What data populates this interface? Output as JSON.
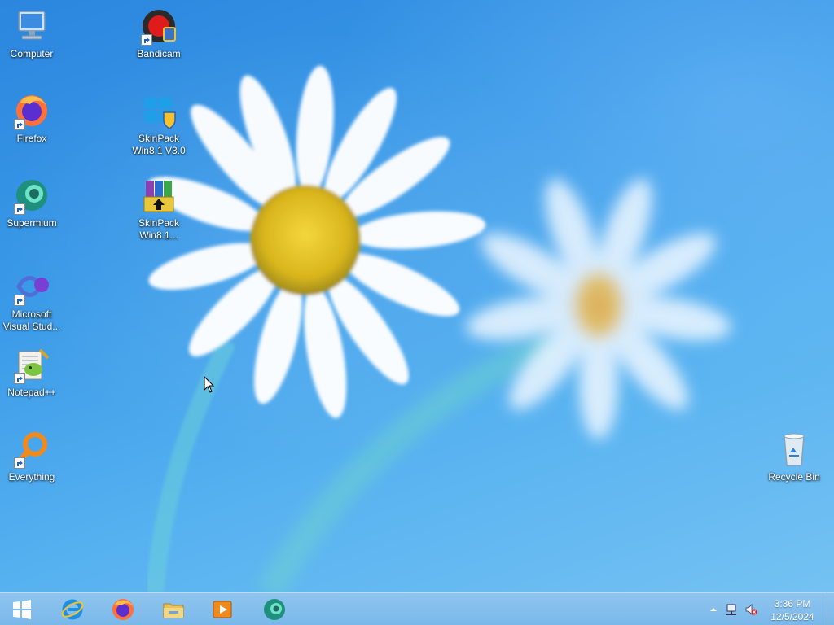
{
  "desktop": {
    "icons": [
      {
        "label": "Computer",
        "icon": "computer-icon"
      },
      {
        "label": "Firefox",
        "icon": "firefox-icon"
      },
      {
        "label": "Supermium",
        "icon": "supermium-icon"
      },
      {
        "label": "Microsoft Visual Stud...",
        "icon": "visual-studio-icon"
      },
      {
        "label": "Notepad++",
        "icon": "notepad-plus-plus-icon"
      },
      {
        "label": "Everything",
        "icon": "everything-search-icon"
      },
      {
        "label": "Bandicam",
        "icon": "bandicam-icon"
      },
      {
        "label": "SkinPack Win8.1 V3.0",
        "icon": "skinpack-installer-icon"
      },
      {
        "label": "SkinPack Win8.1...",
        "icon": "winrar-archive-icon"
      },
      {
        "label": "Recycle Bin",
        "icon": "recycle-bin-icon"
      }
    ]
  },
  "taskbar": {
    "start": {
      "icon": "windows-logo-icon"
    },
    "pinned": [
      {
        "name": "Internet Explorer",
        "icon": "internet-explorer-icon"
      },
      {
        "name": "Firefox",
        "icon": "firefox-icon"
      },
      {
        "name": "File Explorer",
        "icon": "file-explorer-icon"
      },
      {
        "name": "Media Player",
        "icon": "media-player-icon"
      },
      {
        "name": "Supermium",
        "icon": "supermium-icon"
      }
    ],
    "tray": {
      "icons": [
        "show-hidden-icons-chevron",
        "network-icon",
        "volume-muted-icon"
      ],
      "time": "3:36 PM",
      "date": "12/5/2024"
    }
  },
  "colors": {
    "wallpaper": "#3a9ae8",
    "taskbar": "#86bfed",
    "label_text": "#ffffff"
  }
}
